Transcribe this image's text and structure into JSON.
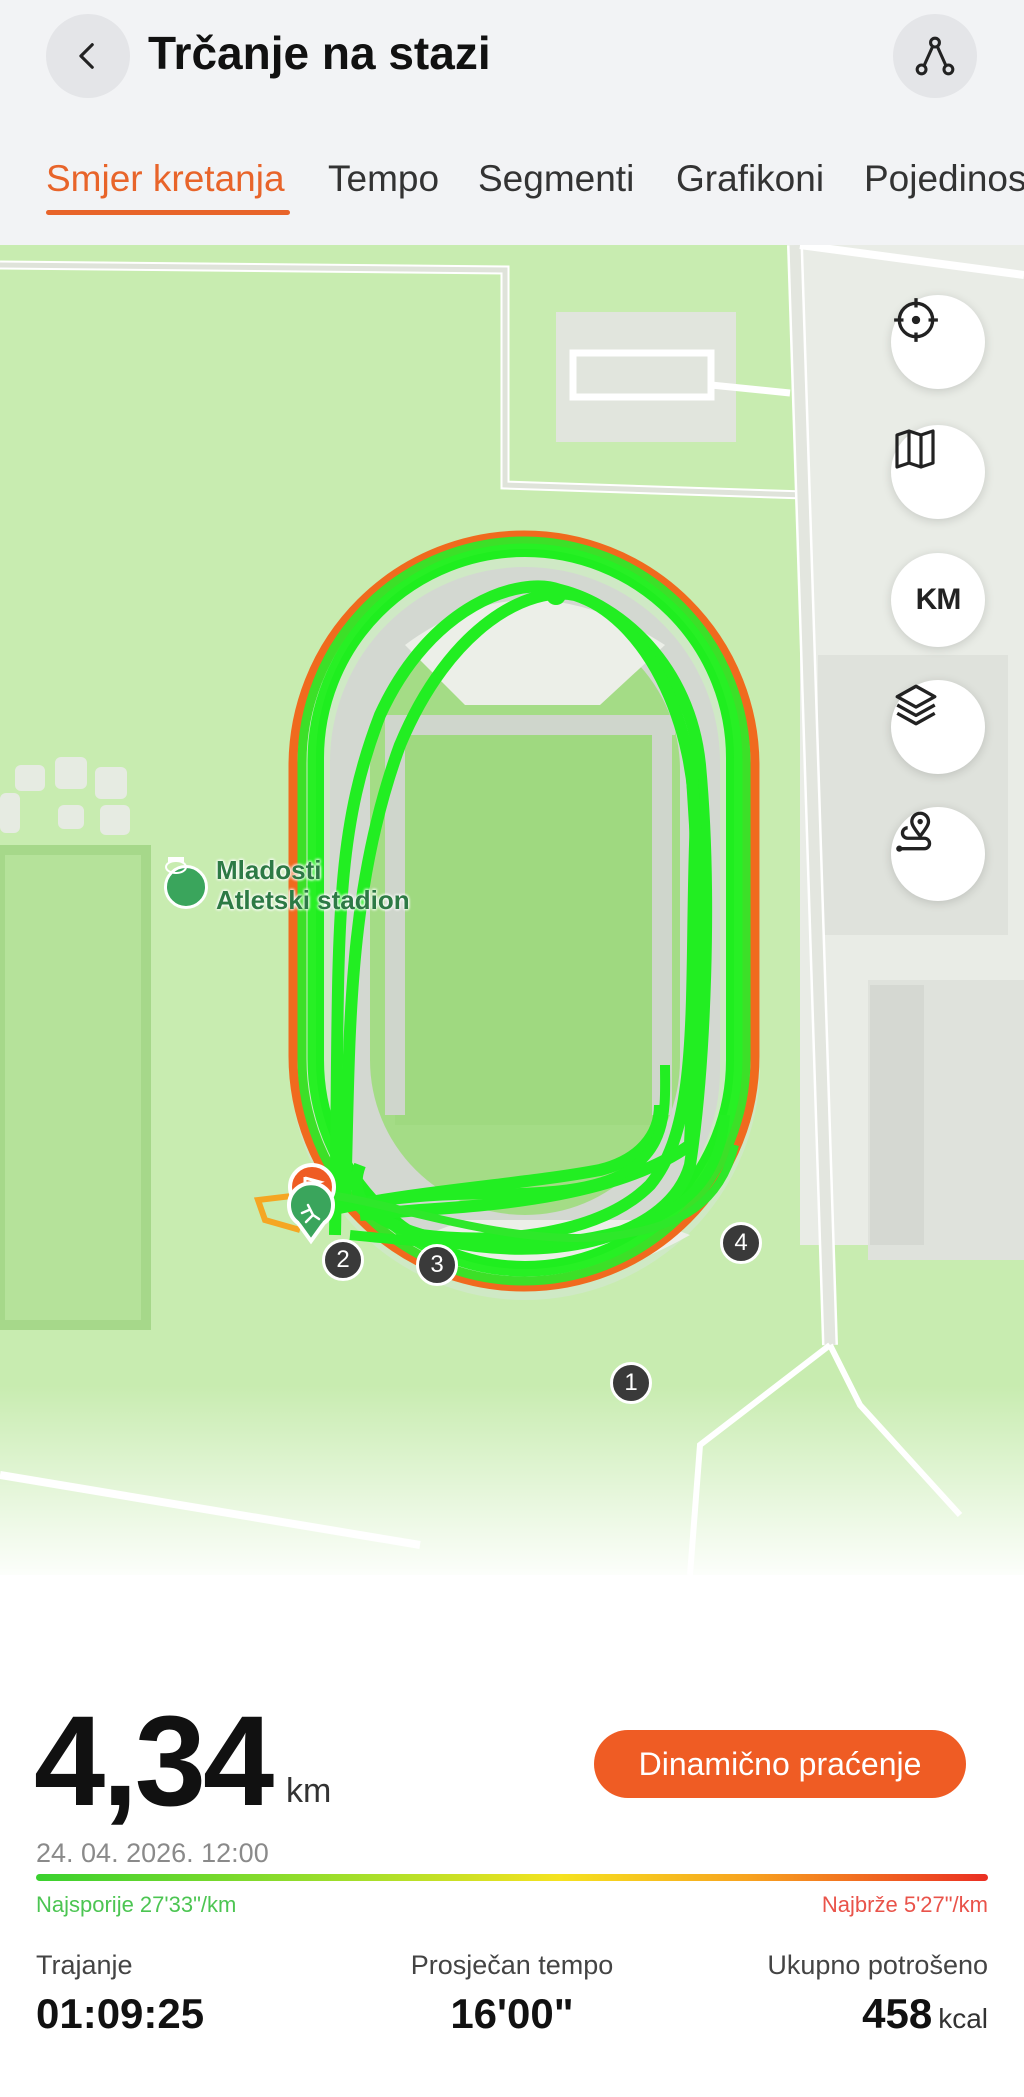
{
  "header": {
    "title": "Trčanje na stazi"
  },
  "tabs": [
    {
      "label": "Smjer kretanja",
      "active": true
    },
    {
      "label": "Tempo",
      "active": false
    },
    {
      "label": "Segmenti",
      "active": false
    },
    {
      "label": "Grafikoni",
      "active": false
    },
    {
      "label": "Pojedinosti",
      "active": false
    }
  ],
  "map": {
    "poi_label_line1": "Mladosti",
    "poi_label_line2": "Atletski stadion",
    "controls": {
      "locate_icon": "crosshair-icon",
      "map_type_icon": "map-icon",
      "units_label": "KM",
      "layers_icon": "layers-icon",
      "route_icon": "route-pin-icon"
    },
    "km_markers": [
      "1",
      "2",
      "3",
      "4"
    ]
  },
  "summary": {
    "distance": "4,34",
    "distance_unit": "km",
    "datetime": "24. 04. 2026. 12:00",
    "dynamic_button": "Dinamično praćenje",
    "slowest": "Najsporije 27'33\"/km",
    "fastest": "Najbrže 5'27\"/km"
  },
  "stats": {
    "duration_label": "Trajanje",
    "duration_value": "01:09:25",
    "pace_label": "Prosječan tempo",
    "pace_value": "16'00\"",
    "calories_label": "Ukupno potrošeno",
    "calories_value": "458",
    "calories_unit": "kcal"
  },
  "colors": {
    "accent": "#e8642a",
    "button": "#ef5c24",
    "route_green": "#22ee22",
    "route_orange": "#f06a1e",
    "map_grass": "#c8ecb0"
  }
}
